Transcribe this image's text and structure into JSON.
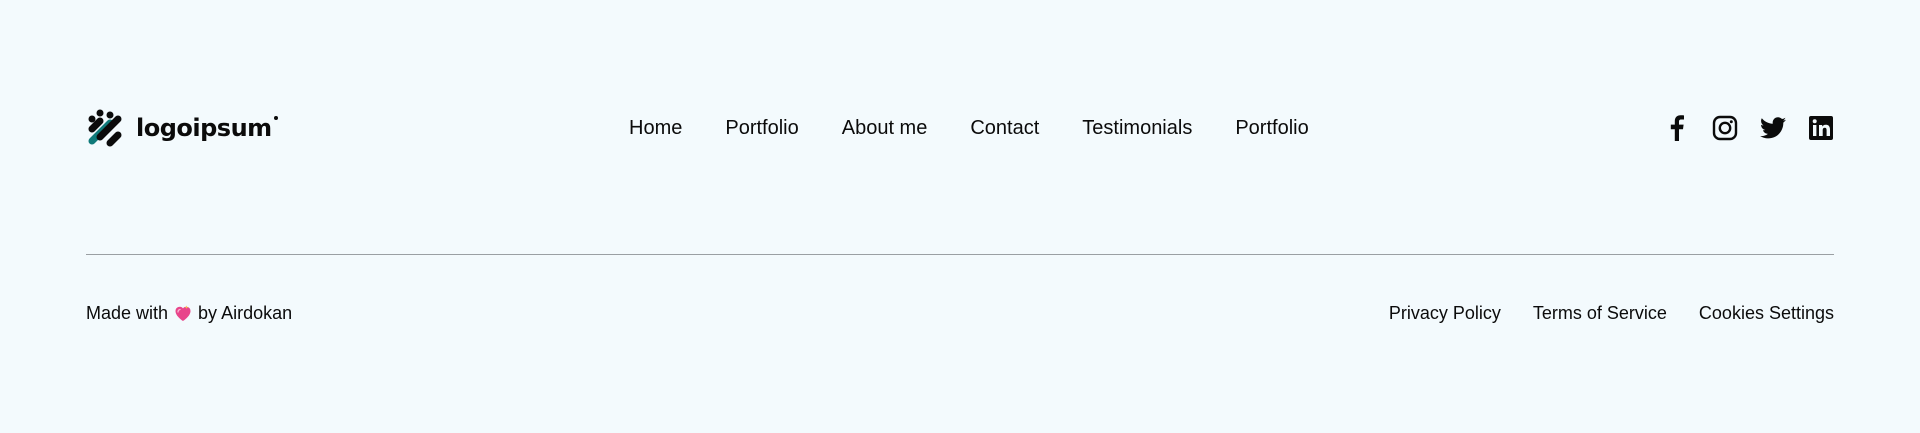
{
  "logo": {
    "text": "logoipsum",
    "icon": "logo-mark-icon",
    "colors": {
      "dark": "#0b0b0b",
      "teal": "#0f7a7a"
    }
  },
  "nav": {
    "items": [
      {
        "label": "Home"
      },
      {
        "label": "Portfolio"
      },
      {
        "label": "About me"
      },
      {
        "label": "Contact"
      },
      {
        "label": "Testimonials"
      },
      {
        "label": "Portfolio"
      }
    ]
  },
  "social": {
    "icons": [
      "facebook-icon",
      "instagram-icon",
      "twitter-icon",
      "linkedin-icon"
    ]
  },
  "credit": {
    "prefix": "Made with",
    "icon": "heart-icon",
    "suffix": "by Airdokan"
  },
  "legal": {
    "links": [
      {
        "label": "Privacy Policy"
      },
      {
        "label": "Terms of Service"
      },
      {
        "label": "Cookies Settings"
      }
    ]
  },
  "theme": {
    "background": "#f3fafd",
    "text": "#0b0b0b",
    "divider": "#9a9fa3",
    "heart": "#e8458b"
  }
}
